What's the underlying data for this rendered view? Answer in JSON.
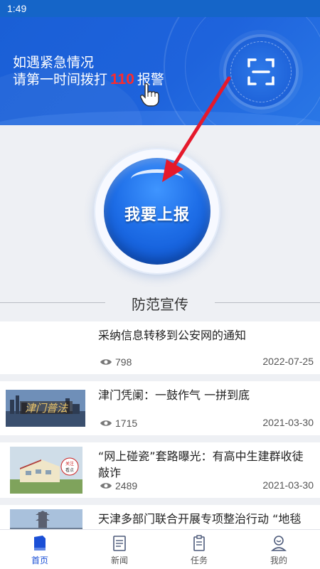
{
  "status_bar": {
    "time": "1:49"
  },
  "hero": {
    "line1": "如遇紧急情况",
    "line2_prefix": "请第一时间拨打",
    "hotline": "110",
    "line2_suffix": "报警"
  },
  "report_button": {
    "label": "我要上报"
  },
  "section": {
    "title": "防范宣传"
  },
  "news": [
    {
      "title": "采纳信息转移到公安网的通知",
      "views": "798",
      "date": "2022-07-25",
      "thumb": "none"
    },
    {
      "title": "津门凭阑：一鼓作气 一拼到底",
      "views": "1715",
      "date": "2021-03-30",
      "thumb": "skyline"
    },
    {
      "title": "“网上碰瓷”套路曝光：有高中生建群收徒敲诈",
      "views": "2489",
      "date": "2021-03-30",
      "thumb": "building"
    },
    {
      "title": "天津多部门联合开展专项整治行动 “地毯式”排查各化品安全隐患",
      "views": "",
      "date": "",
      "thumb": "pagoda"
    }
  ],
  "tabs": [
    {
      "label": "首页",
      "icon": "home-icon",
      "active": true
    },
    {
      "label": "新闻",
      "icon": "news-icon",
      "active": false
    },
    {
      "label": "任务",
      "icon": "task-icon",
      "active": false
    },
    {
      "label": "我的",
      "icon": "profile-icon",
      "active": false
    }
  ],
  "colors": {
    "primary": "#1a5fd6",
    "hotline": "#ff2a2a",
    "tab_active": "#1a4fd6"
  }
}
